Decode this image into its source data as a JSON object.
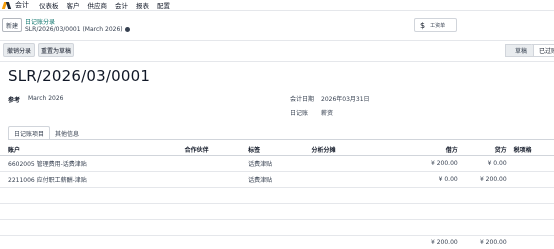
{
  "topbar": {
    "app_name": "会计",
    "menus": [
      "仪表板",
      "客户",
      "供应商",
      "会计",
      "报表",
      "配置"
    ]
  },
  "control": {
    "new_label": "新建",
    "breadcrumb_parent": "日记账分录",
    "breadcrumb_current": "SLR/2026/03/0001 (March 2026)",
    "expense_label": "工资单"
  },
  "actions": {
    "reverse_label": "撤销分录",
    "reset_label": "重置为草稿",
    "status_draft": "草稿",
    "status_posted": "已过账"
  },
  "record": {
    "title": "SLR/2026/03/0001",
    "ref_label": "参考",
    "ref_value": "March 2026",
    "date_label": "会计日期",
    "date_value": "2026年03月31日",
    "journal_label": "日记账",
    "journal_value": "薪资"
  },
  "tabs": [
    "日记账项目",
    "其他信息"
  ],
  "table": {
    "headers": [
      "账户",
      "合作伙伴",
      "标签",
      "分析分摊",
      "借方",
      "贷方",
      "税项格"
    ],
    "rows": [
      {
        "account": "6602005 管理费用-话费津贴",
        "partner": "",
        "label": "话费津贴",
        "analytic": "",
        "debit": "¥ 200.00",
        "credit": "¥ 0.00",
        "tax": ""
      },
      {
        "account": "2211006 应付职工薪酬-津贴",
        "partner": "",
        "label": "话费津贴",
        "analytic": "",
        "debit": "¥ 0.00",
        "credit": "¥ 200.00",
        "tax": ""
      }
    ],
    "total_debit": "¥ 200.00",
    "total_credit": "¥ 200.00"
  }
}
